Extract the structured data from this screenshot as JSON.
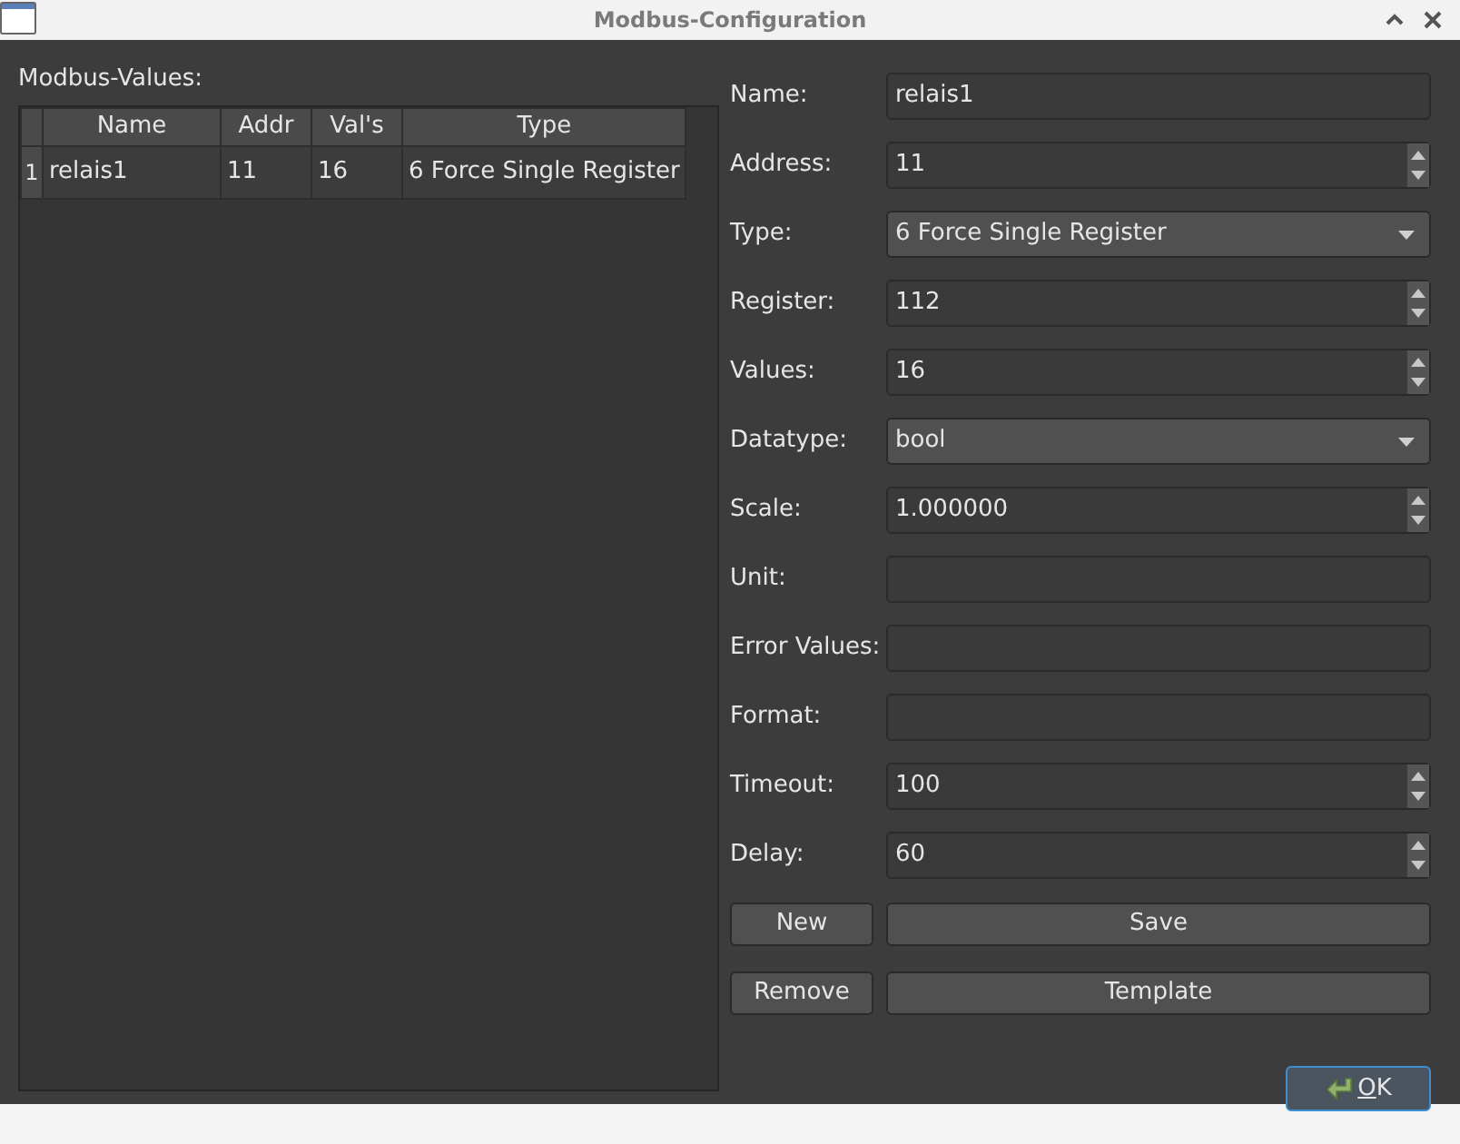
{
  "window": {
    "title": "Modbus-Configuration"
  },
  "list_label": "Modbus-Values:",
  "table": {
    "columns": [
      "Name",
      "Addr",
      "Val's",
      "Type"
    ],
    "rows": [
      {
        "number": "1",
        "cells": [
          "relais1",
          "11",
          "16",
          "6 Force Single Register"
        ]
      }
    ]
  },
  "form": [
    {
      "label": "Name:",
      "kind": "text",
      "value": "relais1"
    },
    {
      "label": "Address:",
      "kind": "spin",
      "value": "11"
    },
    {
      "label": "Type:",
      "kind": "combo",
      "value": "6 Force Single Register"
    },
    {
      "label": "Register:",
      "kind": "spin",
      "value": "112"
    },
    {
      "label": "Values:",
      "kind": "spin",
      "value": "16"
    },
    {
      "label": "Datatype:",
      "kind": "combo",
      "value": "bool"
    },
    {
      "label": "Scale:",
      "kind": "spin",
      "value": "1.000000"
    },
    {
      "label": "Unit:",
      "kind": "text"
    },
    {
      "label": "Error Values:",
      "kind": "text"
    },
    {
      "label": "Format:",
      "kind": "text"
    },
    {
      "label": "Timeout:",
      "kind": "spin",
      "value": "100"
    },
    {
      "label": "Delay:",
      "kind": "spin",
      "value": "60"
    }
  ],
  "buttons": [
    [
      "New",
      "Save"
    ],
    [
      "Remove",
      "Template"
    ]
  ],
  "ok_button": {
    "label": "OK"
  }
}
